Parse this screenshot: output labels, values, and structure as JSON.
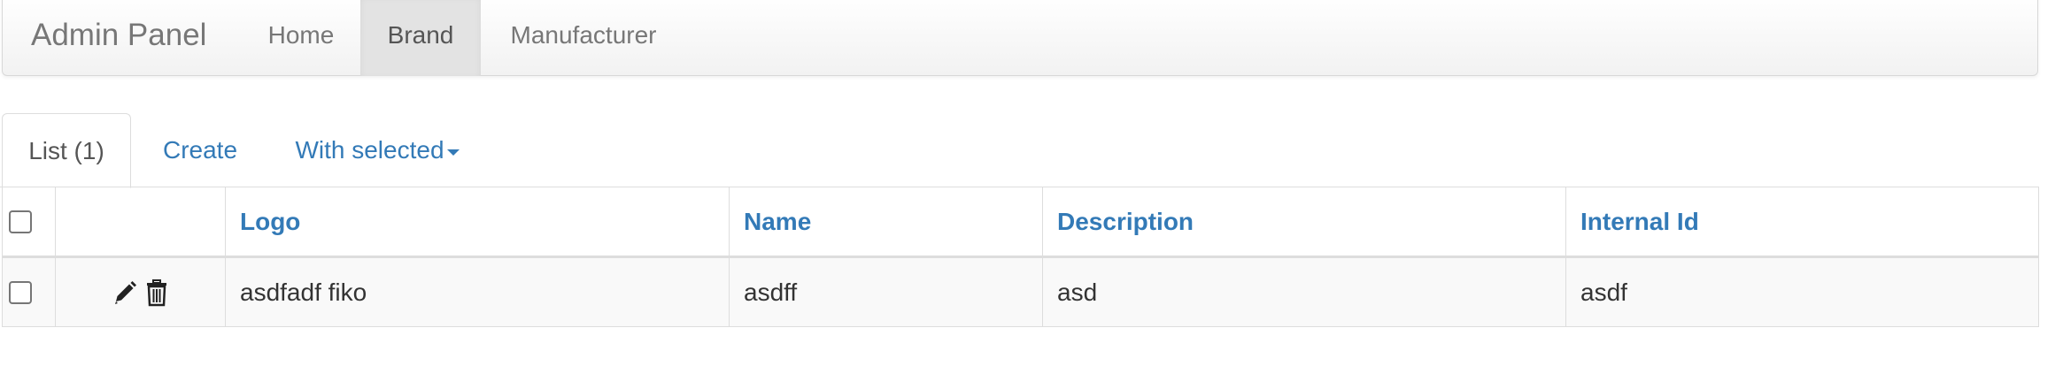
{
  "navbar": {
    "brand": "Admin Panel",
    "items": [
      {
        "label": "Home",
        "active": false
      },
      {
        "label": "Brand",
        "active": true
      },
      {
        "label": "Manufacturer",
        "active": false
      }
    ]
  },
  "tabs": {
    "list_label": "List (1)",
    "create_label": "Create",
    "with_selected_label": "With selected"
  },
  "table": {
    "columns": [
      "Logo",
      "Name",
      "Description",
      "Internal Id"
    ],
    "rows": [
      {
        "logo": "asdfadf fiko",
        "name": "asdff",
        "description": "asd",
        "internal_id": "asdf"
      }
    ]
  },
  "icons": {
    "edit": "pencil-icon",
    "delete": "trash-icon"
  },
  "colors": {
    "link": "#337ab7",
    "muted_text": "#777777",
    "active_nav_bg": "#e3e3e3",
    "row_bg": "#f9f9f9",
    "border": "#dddddd"
  }
}
